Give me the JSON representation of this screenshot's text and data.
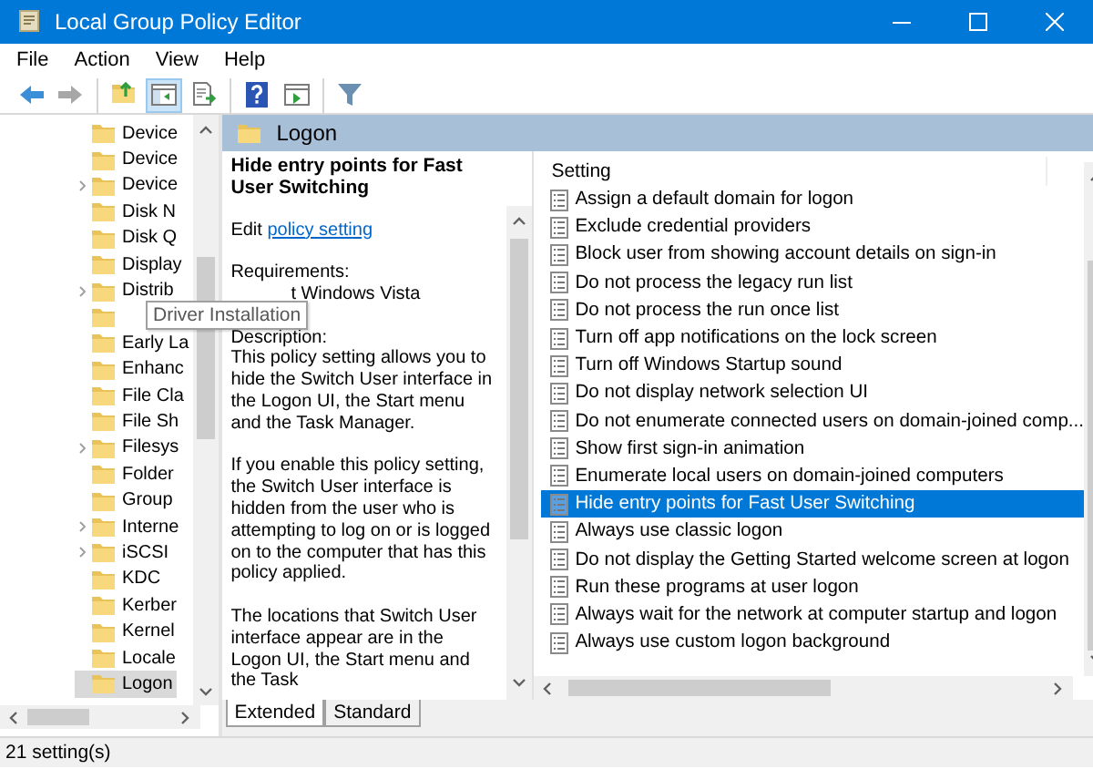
{
  "window": {
    "title": "Local Group Policy Editor"
  },
  "menu": [
    "File",
    "Action",
    "View",
    "Help"
  ],
  "toolbar": [
    [
      {
        "disabled": false,
        "pressed": false
      },
      {
        "disabled": true,
        "pressed": false
      }
    ],
    [
      {
        "disabled": false,
        "pressed": false
      },
      {
        "disabled": false,
        "pressed": true
      },
      {
        "disabled": false,
        "pressed": false
      }
    ],
    [
      {
        "disabled": false,
        "pressed": false
      },
      {
        "disabled": false,
        "pressed": false
      }
    ],
    [
      {
        "disabled": false,
        "pressed": false
      }
    ]
  ],
  "tree": {
    "items": [
      {
        "label": "Device",
        "expandable": false,
        "selected": false
      },
      {
        "label": "Device",
        "expandable": false,
        "selected": false
      },
      {
        "label": "Device",
        "expandable": true,
        "selected": false
      },
      {
        "label": "Disk N",
        "expandable": false,
        "selected": false
      },
      {
        "label": "Disk Q",
        "expandable": false,
        "selected": false
      },
      {
        "label": "Display",
        "expandable": false,
        "selected": false
      },
      {
        "label": "Distrib",
        "expandable": true,
        "selected": false
      },
      {
        "expandable": false,
        "selected": false
      },
      {
        "label": "Early La",
        "expandable": false,
        "selected": false
      },
      {
        "label": "Enhanc",
        "expandable": false,
        "selected": false
      },
      {
        "label": "File Cla",
        "expandable": false,
        "selected": false
      },
      {
        "label": "File Sh",
        "expandable": false,
        "selected": false
      },
      {
        "label": "Filesys",
        "expandable": true,
        "selected": false
      },
      {
        "label": "Folder",
        "expandable": false,
        "selected": false
      },
      {
        "label": "Group",
        "expandable": false,
        "selected": false
      },
      {
        "label": "Interne",
        "expandable": true,
        "selected": false
      },
      {
        "label": "iSCSI",
        "expandable": true,
        "selected": false
      },
      {
        "label": "KDC",
        "expandable": false,
        "selected": false
      },
      {
        "label": "Kerber",
        "expandable": false,
        "selected": false
      },
      {
        "label": "Kernel",
        "expandable": false,
        "selected": false
      },
      {
        "label": "Locale",
        "expandable": false,
        "selected": false
      },
      {
        "label": "Logon",
        "expandable": false,
        "selected": true
      }
    ]
  },
  "tooltip": "Driver Installation",
  "details": {
    "header": "Logon",
    "title": "Hide entry points for Fast User Switching",
    "edit_prefix": "Edit",
    "edit_link": "policy setting",
    "requirements_label": "Requirements:",
    "requirements": "t Windows Vista",
    "description_label": "Description:",
    "paragraphs": [
      "This policy setting allows you to hide the Switch User interface in the Logon UI, the Start menu and the Task Manager.",
      "If you enable this policy setting, the Switch User interface is hidden from the user who is attempting to log on or is logged on to the computer that has this policy applied.",
      "The locations that Switch User interface appear are in the Logon UI, the Start menu and the Task"
    ]
  },
  "tabs": [
    {
      "label": "Extended",
      "selected": true
    },
    {
      "label": "Standard",
      "selected": false
    }
  ],
  "settings": {
    "column": "Setting",
    "rows": [
      {
        "label": "Assign a default domain for logon",
        "selected": false
      },
      {
        "label": "Exclude credential providers",
        "selected": false
      },
      {
        "label": "Block user from showing account details on sign-in",
        "selected": false
      },
      {
        "label": "Do not process the legacy run list",
        "selected": false
      },
      {
        "label": "Do not process the run once list",
        "selected": false
      },
      {
        "label": "Turn off app notifications on the lock screen",
        "selected": false
      },
      {
        "label": "Turn off Windows Startup sound",
        "selected": false
      },
      {
        "label": "Do not display network selection UI",
        "selected": false
      },
      {
        "label": "Do not enumerate connected users on domain-joined comp...",
        "selected": false
      },
      {
        "label": "Show first sign-in animation",
        "selected": false
      },
      {
        "label": "Enumerate local users on domain-joined computers",
        "selected": false
      },
      {
        "label": "Hide entry points for Fast User Switching",
        "selected": true
      },
      {
        "label": "Always use classic logon",
        "selected": false
      },
      {
        "label": "Do not display the Getting Started welcome screen at logon",
        "selected": false
      },
      {
        "label": "Run these programs at user logon",
        "selected": false
      },
      {
        "label": "Always wait for the network at computer startup and logon",
        "selected": false
      },
      {
        "label": "Always use custom logon background",
        "selected": false
      }
    ]
  },
  "status_bar": "21 setting(s)"
}
